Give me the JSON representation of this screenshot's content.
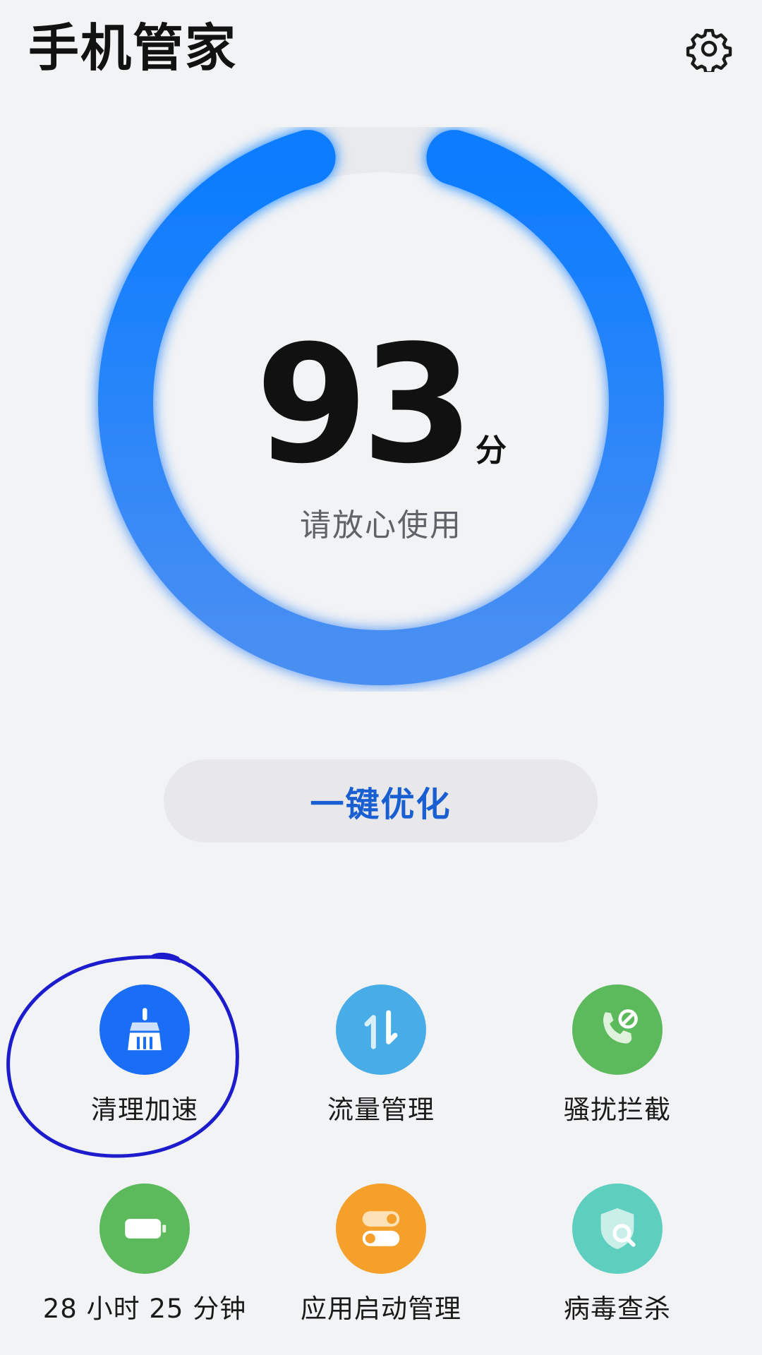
{
  "header": {
    "title": "手机管家",
    "settings_icon": "gear-icon"
  },
  "gauge": {
    "score": "93",
    "unit": "分",
    "status": "请放心使用",
    "progress_percent": 93,
    "colors": {
      "start": "#0a7cff",
      "end": "#4a8ff2",
      "track": "#e9eaed"
    }
  },
  "optimize_button": {
    "label": "一键优化",
    "color": "#1a5fd1"
  },
  "tools": [
    {
      "label": "清理加速",
      "icon": "broom-icon",
      "color": "#1a6ef5"
    },
    {
      "label": "流量管理",
      "icon": "data-transfer-icon",
      "color": "#48ade6"
    },
    {
      "label": "骚扰拦截",
      "icon": "phone-block-icon",
      "color": "#5cba5c"
    },
    {
      "label": "28 小时 25 分钟",
      "icon": "battery-icon",
      "color": "#5cba5c"
    },
    {
      "label": "应用启动管理",
      "icon": "toggle-icon",
      "color": "#f5a02a"
    },
    {
      "label": "病毒查杀",
      "icon": "shield-search-icon",
      "color": "#5ecfbf"
    }
  ],
  "annotation": {
    "color": "#1c1ccc"
  }
}
